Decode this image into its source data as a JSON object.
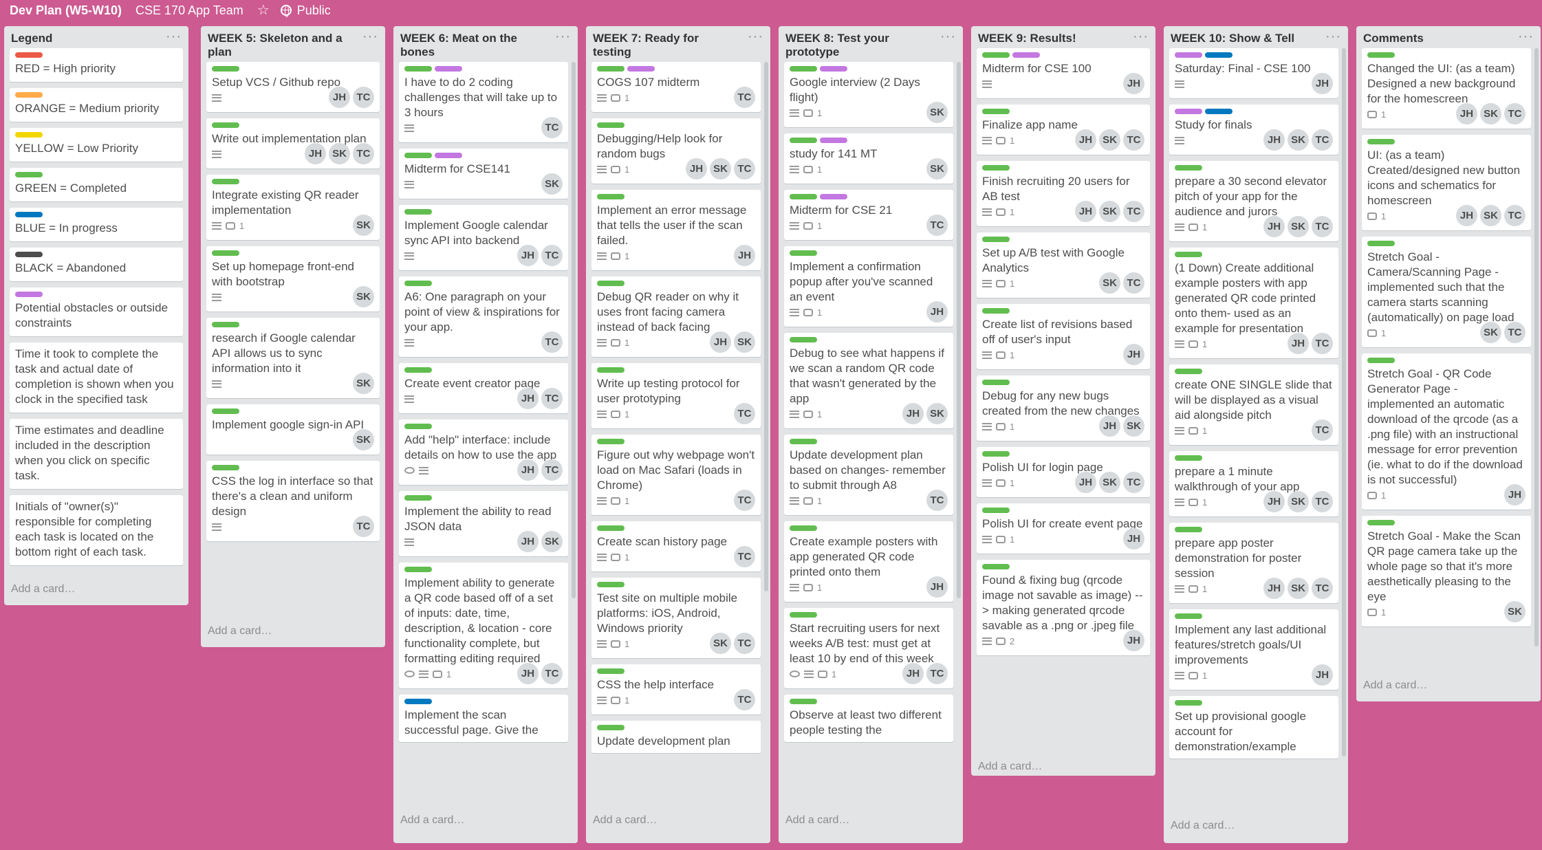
{
  "header": {
    "board_title": "Dev Plan (W5-W10)",
    "team": "CSE 170 App Team",
    "visibility": "Public"
  },
  "colors": {
    "green": "#61bd4f",
    "purple": "#c377e0",
    "blue": "#0079bf",
    "red": "#eb5a46",
    "orange": "#ffab4a",
    "yellow": "#f2d600",
    "black": "#4d4d4d"
  },
  "add_card": "Add a card…",
  "lists": [
    {
      "title": "Legend",
      "cards": [
        {
          "labels": [
            "red"
          ],
          "text": "RED = High priority",
          "members": []
        },
        {
          "labels": [
            "orange"
          ],
          "text": "ORANGE = Medium priority",
          "members": []
        },
        {
          "labels": [
            "yellow"
          ],
          "text": "YELLOW = Low Priority",
          "members": []
        },
        {
          "labels": [
            "green"
          ],
          "text": "GREEN = Completed",
          "members": []
        },
        {
          "labels": [
            "blue"
          ],
          "text": "BLUE = In progress",
          "members": []
        },
        {
          "labels": [
            "black"
          ],
          "text": "BLACK = Abandoned",
          "members": []
        },
        {
          "labels": [
            "purple"
          ],
          "text": "Potential obstacles or outside constraints",
          "members": []
        },
        {
          "labels": [],
          "text": "Time it took to complete the task and actual date of completion is shown when you clock in the specified task",
          "members": []
        },
        {
          "labels": [],
          "text": "Time estimates and deadline included in the description when you click on specific task.",
          "members": []
        },
        {
          "labels": [],
          "text": "Initials of \"owner(s)\" responsible for completing each task is located on the bottom right of each task.",
          "members": []
        }
      ]
    },
    {
      "title": "WEEK 5: Skeleton and a plan",
      "cards": [
        {
          "labels": [
            "green"
          ],
          "text": "Setup VCS / Github repo",
          "desc": true,
          "members": [
            "JH",
            "TC"
          ]
        },
        {
          "labels": [
            "green"
          ],
          "text": "Write out implementation plan",
          "desc": true,
          "members": [
            "JH",
            "SK",
            "TC"
          ]
        },
        {
          "labels": [
            "green"
          ],
          "text": "Integrate existing QR reader implementation",
          "desc": true,
          "comments": "1",
          "members": [
            "SK"
          ]
        },
        {
          "labels": [
            "green"
          ],
          "text": "Set up homepage front-end with bootstrap",
          "desc": true,
          "members": [
            "SK"
          ]
        },
        {
          "labels": [
            "green"
          ],
          "text": "research if Google calendar API allows us to sync information into it",
          "desc": true,
          "members": [
            "SK"
          ]
        },
        {
          "labels": [
            "green"
          ],
          "text": "Implement google sign-in API",
          "members": [
            "SK"
          ]
        },
        {
          "labels": [
            "green"
          ],
          "text": "CSS the log in interface so that there's a clean and uniform design",
          "desc": true,
          "members": [
            "TC"
          ]
        }
      ]
    },
    {
      "title": "WEEK 6: Meat on the bones",
      "cards": [
        {
          "labels": [
            "green",
            "purple"
          ],
          "text": "I have to do 2 coding challenges that will take up to 3 hours",
          "desc": true,
          "members": [
            "TC"
          ]
        },
        {
          "labels": [
            "green",
            "purple"
          ],
          "text": "Midterm for CSE141",
          "desc": true,
          "members": [
            "SK"
          ]
        },
        {
          "labels": [
            "green"
          ],
          "text": "Implement Google calendar sync API into backend",
          "desc": true,
          "members": [
            "JH",
            "TC"
          ]
        },
        {
          "labels": [
            "green"
          ],
          "text": "A6: One paragraph on your point of view & inspirations for your app.",
          "desc": true,
          "members": [
            "TC"
          ]
        },
        {
          "labels": [
            "green"
          ],
          "text": "Create event creator page",
          "desc": true,
          "members": [
            "JH",
            "TC"
          ]
        },
        {
          "labels": [
            "green"
          ],
          "text": "Add \"help\" interface: include details on how to use the app",
          "watch": true,
          "desc": true,
          "members": [
            "JH",
            "TC"
          ]
        },
        {
          "labels": [
            "green"
          ],
          "text": "Implement the ability to read JSON data",
          "desc": true,
          "members": [
            "JH",
            "SK"
          ]
        },
        {
          "labels": [
            "green"
          ],
          "text": "Implement ability to generate a QR code based off of a set of inputs: date, time, description, & location - core functionality complete, but formatting editing required",
          "watch": true,
          "desc": true,
          "comments": "1",
          "members": [
            "JH",
            "TC"
          ]
        },
        {
          "labels": [
            "blue"
          ],
          "text": "Implement the scan successful page. Give the",
          "members": []
        }
      ]
    },
    {
      "title": "WEEK 7: Ready for testing",
      "cards": [
        {
          "labels": [
            "green",
            "purple"
          ],
          "text": "COGS 107 midterm",
          "desc": true,
          "comments": "1",
          "members": [
            "TC"
          ]
        },
        {
          "labels": [
            "green"
          ],
          "text": "Debugging/Help look for random bugs",
          "desc": true,
          "comments": "1",
          "members": [
            "JH",
            "SK",
            "TC"
          ]
        },
        {
          "labels": [
            "green"
          ],
          "text": "Implement an error message that tells the user if the scan failed.",
          "desc": true,
          "comments": "1",
          "members": [
            "JH"
          ]
        },
        {
          "labels": [
            "green"
          ],
          "text": "Debug QR reader on why it uses front facing camera instead of back facing",
          "desc": true,
          "comments": "1",
          "members": [
            "JH",
            "SK"
          ]
        },
        {
          "labels": [
            "green"
          ],
          "text": "Write up testing protocol for user prototyping",
          "desc": true,
          "comments": "1",
          "members": [
            "TC"
          ]
        },
        {
          "labels": [
            "green"
          ],
          "text": "Figure out why webpage won't load on Mac Safari (loads in Chrome)",
          "desc": true,
          "comments": "1",
          "members": [
            "TC"
          ]
        },
        {
          "labels": [
            "green"
          ],
          "text": "Create scan history page",
          "desc": true,
          "comments": "1",
          "members": [
            "TC"
          ]
        },
        {
          "labels": [
            "green"
          ],
          "text": "Test site on multiple mobile platforms: iOS, Android, Windows priority",
          "desc": true,
          "comments": "1",
          "members": [
            "SK",
            "TC"
          ]
        },
        {
          "labels": [
            "green"
          ],
          "text": "CSS the help interface",
          "desc": true,
          "comments": "1",
          "members": [
            "TC"
          ]
        },
        {
          "labels": [
            "green"
          ],
          "text": "Update development plan",
          "members": []
        }
      ]
    },
    {
      "title": "WEEK 8: Test your prototype",
      "cards": [
        {
          "labels": [
            "green",
            "purple"
          ],
          "text": "Google interview (2 Days flight)",
          "desc": true,
          "comments": "1",
          "members": [
            "SK"
          ]
        },
        {
          "labels": [
            "green",
            "purple"
          ],
          "text": "study for 141 MT",
          "desc": true,
          "comments": "1",
          "members": [
            "SK"
          ]
        },
        {
          "labels": [
            "green",
            "purple"
          ],
          "text": "Midterm for CSE 21",
          "desc": true,
          "comments": "1",
          "members": [
            "TC"
          ]
        },
        {
          "labels": [
            "green"
          ],
          "text": "Implement a confirmation popup after you've scanned an event",
          "desc": true,
          "comments": "1",
          "members": [
            "JH"
          ]
        },
        {
          "labels": [
            "green"
          ],
          "text": "Debug to see what happens if we scan a random QR code that wasn't generated by the app",
          "desc": true,
          "comments": "1",
          "members": [
            "JH",
            "SK"
          ]
        },
        {
          "labels": [
            "green"
          ],
          "text": "Update development plan based on changes- remember to submit through A8",
          "desc": true,
          "comments": "1",
          "members": [
            "TC"
          ]
        },
        {
          "labels": [
            "green"
          ],
          "text": "Create example posters with app generated QR code printed onto them",
          "desc": true,
          "comments": "1",
          "members": [
            "JH"
          ]
        },
        {
          "labels": [
            "green"
          ],
          "text": "Start recruiting users for next weeks A/B test: must get at least 10 by end of this week",
          "watch": true,
          "desc": true,
          "comments": "1",
          "members": [
            "JH",
            "TC"
          ]
        },
        {
          "labels": [
            "green"
          ],
          "text": "Observe at least two different people testing the",
          "members": []
        }
      ]
    },
    {
      "title": "WEEK 9: Results!",
      "cards": [
        {
          "labels": [
            "green",
            "purple"
          ],
          "text": "Midterm for CSE 100",
          "desc": true,
          "members": [
            "JH"
          ]
        },
        {
          "labels": [
            "green"
          ],
          "text": "Finalize app name",
          "desc": true,
          "comments": "1",
          "members": [
            "JH",
            "SK",
            "TC"
          ]
        },
        {
          "labels": [
            "green"
          ],
          "text": "Finish recruiting 20 users for AB test",
          "desc": true,
          "comments": "1",
          "members": [
            "JH",
            "SK",
            "TC"
          ]
        },
        {
          "labels": [
            "green"
          ],
          "text": "Set up A/B test with Google Analytics",
          "desc": true,
          "comments": "1",
          "members": [
            "SK",
            "TC"
          ]
        },
        {
          "labels": [
            "green"
          ],
          "text": "Create list of revisions based off of user's input",
          "desc": true,
          "comments": "1",
          "members": [
            "JH"
          ]
        },
        {
          "labels": [
            "green"
          ],
          "text": "Debug for any new bugs created from the new changes",
          "desc": true,
          "comments": "1",
          "members": [
            "JH",
            "SK"
          ]
        },
        {
          "labels": [
            "green"
          ],
          "text": "Polish UI for login page",
          "desc": true,
          "comments": "1",
          "members": [
            "JH",
            "SK",
            "TC"
          ]
        },
        {
          "labels": [
            "green"
          ],
          "text": "Polish UI for create event page",
          "desc": true,
          "comments": "1",
          "members": [
            "JH"
          ]
        },
        {
          "labels": [
            "green"
          ],
          "text": "Found & fixing bug (qrcode image not savable as image) --> making generated qrcode savable as a .png or .jpeg file",
          "desc": true,
          "comments": "2",
          "members": [
            "JH"
          ]
        }
      ]
    },
    {
      "title": "WEEK 10: Show & Tell",
      "cards": [
        {
          "labels": [
            "purple",
            "blue"
          ],
          "text": "Saturday: Final - CSE 100",
          "desc": true,
          "members": [
            "JH"
          ]
        },
        {
          "labels": [
            "purple",
            "blue"
          ],
          "text": "Study for finals",
          "desc": true,
          "members": [
            "JH",
            "SK",
            "TC"
          ]
        },
        {
          "labels": [
            "green"
          ],
          "text": "prepare a 30 second elevator pitch of your app for the audience and jurors",
          "desc": true,
          "comments": "1",
          "members": [
            "JH",
            "SK",
            "TC"
          ]
        },
        {
          "labels": [
            "green"
          ],
          "text": "(1 Down) Create additional example posters with app generated QR code printed onto them- used as an example for presentation",
          "desc": true,
          "comments": "1",
          "members": [
            "JH",
            "TC"
          ]
        },
        {
          "labels": [
            "green"
          ],
          "text": "create ONE SINGLE slide that will be displayed as a visual aid alongside pitch",
          "desc": true,
          "comments": "1",
          "members": [
            "TC"
          ]
        },
        {
          "labels": [
            "green"
          ],
          "text": "prepare a 1 minute walkthrough of your app",
          "desc": true,
          "comments": "1",
          "members": [
            "JH",
            "SK",
            "TC"
          ]
        },
        {
          "labels": [
            "green"
          ],
          "text": "prepare app poster demonstration for poster session",
          "desc": true,
          "comments": "1",
          "members": [
            "JH",
            "SK",
            "TC"
          ]
        },
        {
          "labels": [
            "green"
          ],
          "text": "Implement any last additional features/stretch goals/UI improvements",
          "desc": true,
          "comments": "1",
          "members": [
            "JH"
          ]
        },
        {
          "labels": [
            "green"
          ],
          "text": "Set up provisional google account for demonstration/example",
          "members": []
        }
      ]
    },
    {
      "title": "Comments",
      "cards": [
        {
          "labels": [
            "green"
          ],
          "text": "Changed the UI: (as a team) Designed a new background for the homescreen",
          "comments": "1",
          "members": [
            "JH",
            "SK",
            "TC"
          ]
        },
        {
          "labels": [
            "green"
          ],
          "text": "UI: (as a team) Created/designed new button icons and schematics for homescreen",
          "comments": "1",
          "members": [
            "JH",
            "SK",
            "TC"
          ]
        },
        {
          "labels": [
            "green"
          ],
          "text": "Stretch Goal - Camera/Scanning Page - implemented such that the camera starts scanning (automatically) on page load",
          "comments": "1",
          "members": [
            "SK",
            "TC"
          ]
        },
        {
          "labels": [
            "green"
          ],
          "text": "Stretch Goal - QR Code Generator Page - implemented an automatic download of the qrcode (as a .png file) with an instructional message for error prevention (ie. what to do if the download is not successful)",
          "comments": "1",
          "members": [
            "JH"
          ]
        },
        {
          "labels": [
            "green"
          ],
          "text": "Stretch Goal - Make the Scan QR page camera take up the whole page so that it's more aesthetically pleasing to the eye",
          "comments": "1",
          "members": [
            "SK"
          ]
        }
      ]
    }
  ]
}
